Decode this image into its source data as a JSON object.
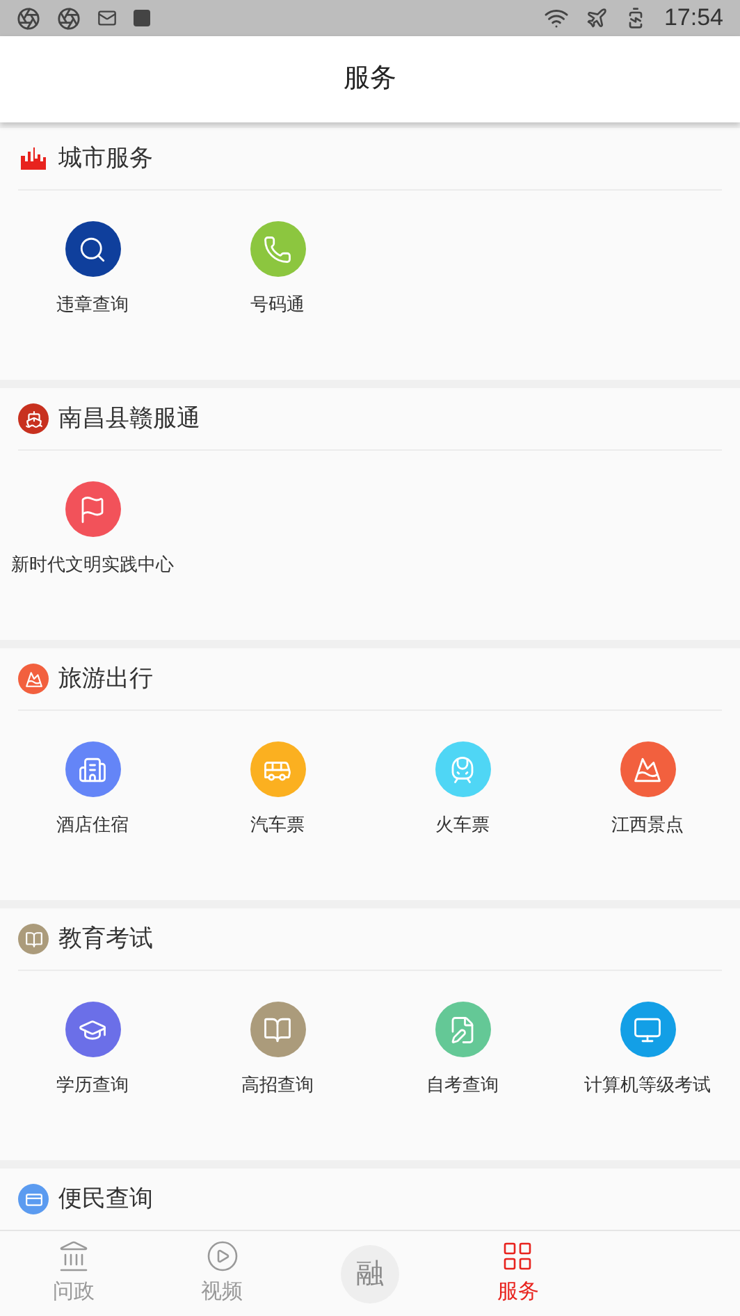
{
  "status_bar": {
    "time": "17:54"
  },
  "header": {
    "title": "服务"
  },
  "sections": [
    {
      "title": "城市服务",
      "kind": "city",
      "color": "#e8231e",
      "items": [
        {
          "label": "违章查询",
          "kind": "search",
          "color": "#0f3f9c"
        },
        {
          "label": "号码通",
          "kind": "phone",
          "color": "#8cc63f"
        }
      ]
    },
    {
      "title": "南昌县赣服通",
      "kind": "ship",
      "color": "#c8311f",
      "items": [
        {
          "label": "新时代文明实践中心",
          "kind": "flag",
          "color": "#f2525a"
        }
      ]
    },
    {
      "title": "旅游出行",
      "kind": "mountain",
      "color": "#f2603e",
      "items": [
        {
          "label": "酒店住宿",
          "kind": "building",
          "color": "#6485f7"
        },
        {
          "label": "汽车票",
          "kind": "bus",
          "color": "#fbb020"
        },
        {
          "label": "火车票",
          "kind": "train",
          "color": "#4fd6f5"
        },
        {
          "label": "江西景点",
          "kind": "mountain",
          "color": "#f2603e"
        }
      ]
    },
    {
      "title": "教育考试",
      "kind": "book",
      "color": "#ab9b7b",
      "items": [
        {
          "label": "学历查询",
          "kind": "cap",
          "color": "#6b6fe8"
        },
        {
          "label": "高招查询",
          "kind": "book",
          "color": "#ab9b7b"
        },
        {
          "label": "自考查询",
          "kind": "edit",
          "color": "#64c896"
        },
        {
          "label": "计算机等级考试",
          "kind": "monitor",
          "color": "#139fe6"
        }
      ]
    },
    {
      "title": "便民查询",
      "kind": "card",
      "color": "#5b9bf0"
    }
  ],
  "bottom_nav": [
    {
      "label": "问政",
      "kind": "bank",
      "selected": false
    },
    {
      "label": "视频",
      "kind": "play",
      "selected": false
    },
    {
      "label": "融",
      "kind": "round",
      "selected": false
    },
    {
      "label": "服务",
      "kind": "grid",
      "selected": true
    }
  ]
}
